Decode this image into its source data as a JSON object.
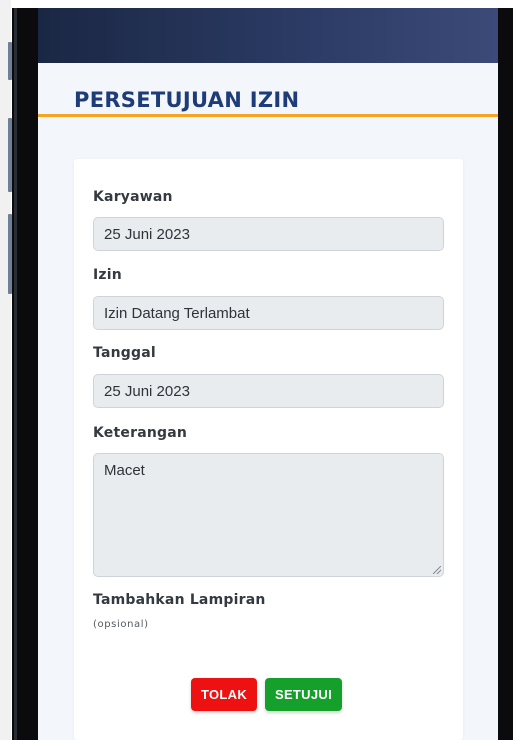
{
  "page": {
    "title": "PERSETUJUAN IZIN"
  },
  "form": {
    "employee": {
      "label": "Karyawan",
      "value": "25 Juni 2023"
    },
    "permit": {
      "label": "Izin",
      "value": "Izin Datang Terlambat"
    },
    "date": {
      "label": "Tanggal",
      "value": "25 Juni 2023"
    },
    "description": {
      "label": "Keterangan",
      "value": "Macet"
    },
    "attachment": {
      "label": "Tambahkan Lampiran",
      "note": "(opsional)"
    }
  },
  "actions": {
    "reject_label": "TOLAK",
    "approve_label": "SETUJUI"
  },
  "colors": {
    "header_dark": "#1a2744",
    "title": "#1d3c78",
    "accent_underline": "#f5a524",
    "reject": "#ee1111",
    "approve": "#159f2b",
    "input_bg": "#e9ecef"
  }
}
